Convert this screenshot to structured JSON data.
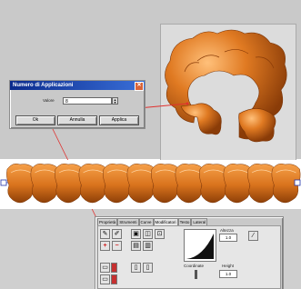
{
  "dialog": {
    "title": "Numero di Applicazioni",
    "value_label": "Valore",
    "value": "8",
    "buttons": [
      "Ok",
      "Annulla",
      "Applica"
    ]
  },
  "panel": {
    "tabs": [
      "Proprietà",
      "Strumenti",
      "Curve",
      "Modificatori",
      "Testo",
      "Lateral"
    ],
    "labels": {
      "width": "Altezza",
      "width_value": "1.0",
      "coordinate": "Coordinate",
      "height": "Height",
      "height_value": "1.0"
    }
  },
  "colors": {
    "accent_orange": "#d9731d",
    "pointer_red": "#e0302e",
    "title_blue": "#1a3fa8"
  },
  "icons": [
    "close-icon",
    "pencil-icon",
    "cross-icon",
    "minus-icon",
    "eyedropper-icon",
    "curve-icon"
  ]
}
